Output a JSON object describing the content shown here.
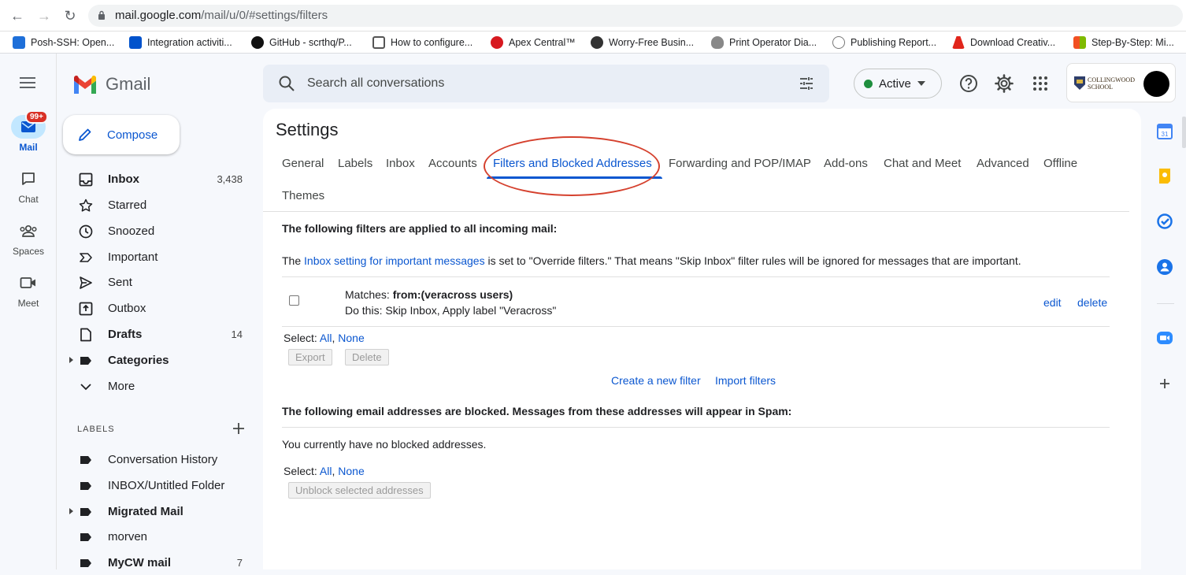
{
  "browser": {
    "url_host": "mail.google.com",
    "url_path": "/mail/u/0/#settings/filters",
    "bookmarks": [
      {
        "label": "Posh-SSH: Open...",
        "color": "#1e6fd9"
      },
      {
        "label": "Integration activiti...",
        "color": "#0052cc"
      },
      {
        "label": "GitHub - scrthq/P...",
        "color": "#111111"
      },
      {
        "label": "How to configure...",
        "color": "#555555"
      },
      {
        "label": "Apex Central™",
        "color": "#d71920"
      },
      {
        "label": "Worry-Free Busin...",
        "color": "#333333"
      },
      {
        "label": "Print Operator Dia...",
        "color": "#888888"
      },
      {
        "label": "Publishing Report...",
        "color": "#777777"
      },
      {
        "label": "Download Creativ...",
        "color": "#e1251b"
      },
      {
        "label": "Step-By-Step: Mi...",
        "color": "#f25022"
      }
    ]
  },
  "rail": {
    "mail": {
      "label": "Mail",
      "badge": "99+"
    },
    "chat": {
      "label": "Chat"
    },
    "spaces": {
      "label": "Spaces"
    },
    "meet": {
      "label": "Meet"
    }
  },
  "app": {
    "name": "Gmail"
  },
  "compose_label": "Compose",
  "nav": [
    {
      "label": "Inbox",
      "count": "3,438",
      "bold": true,
      "icon": "inbox-icon"
    },
    {
      "label": "Starred",
      "count": "",
      "bold": false,
      "icon": "star-icon"
    },
    {
      "label": "Snoozed",
      "count": "",
      "bold": false,
      "icon": "clock-icon"
    },
    {
      "label": "Important",
      "count": "",
      "bold": false,
      "icon": "important-icon"
    },
    {
      "label": "Sent",
      "count": "",
      "bold": false,
      "icon": "send-icon"
    },
    {
      "label": "Outbox",
      "count": "",
      "bold": false,
      "icon": "outbox-icon"
    },
    {
      "label": "Drafts",
      "count": "14",
      "bold": true,
      "icon": "draft-icon"
    },
    {
      "label": "Categories",
      "count": "",
      "bold": true,
      "icon": "label-icon"
    },
    {
      "label": "More",
      "count": "",
      "bold": false,
      "icon": "chevron-down-icon"
    }
  ],
  "labels_header": "LABELS",
  "labels": [
    {
      "label": "Conversation History",
      "count": "",
      "bold": false
    },
    {
      "label": "INBOX/Untitled Folder",
      "count": "",
      "bold": false
    },
    {
      "label": "Migrated Mail",
      "count": "",
      "bold": true
    },
    {
      "label": "morven",
      "count": "",
      "bold": false
    },
    {
      "label": "MyCW mail",
      "count": "7",
      "bold": true
    }
  ],
  "search": {
    "placeholder": "Search all conversations"
  },
  "status": {
    "label": "Active",
    "color": "#1e8e3e"
  },
  "account": {
    "org_line1": "COLLINGWOOD",
    "org_line2": "SCHOOL"
  },
  "settings": {
    "title": "Settings",
    "tabs": [
      "General",
      "Labels",
      "Inbox",
      "Accounts",
      "Filters and Blocked Addresses",
      "Forwarding and POP/IMAP",
      "Add-ons",
      "Chat and Meet",
      "Advanced",
      "Offline",
      "Themes"
    ],
    "active_tab": "Filters and Blocked Addresses",
    "filters_heading": "The following filters are applied to all incoming mail:",
    "info_prefix": "The ",
    "info_link": "Inbox setting for important messages",
    "info_suffix": " is set to \"Override filters.\" That means \"Skip Inbox\" filter rules will be ignored for messages that are important.",
    "filter": {
      "matches_label": "Matches: ",
      "matches_value": "from:(veracross users)",
      "action": "Do this: Skip Inbox, Apply label \"Veracross\"",
      "edit": "edit",
      "delete": "delete"
    },
    "select_label": "Select: ",
    "select_all": "All",
    "select_sep": ", ",
    "select_none": "None",
    "export_btn": "Export",
    "delete_btn": "Delete",
    "create_filter": "Create a new filter",
    "import_filters": "Import filters",
    "blocked_heading": "The following email addresses are blocked. Messages from these addresses will appear in Spam:",
    "no_blocked": "You currently have no blocked addresses.",
    "unblock_btn": "Unblock selected addresses"
  }
}
